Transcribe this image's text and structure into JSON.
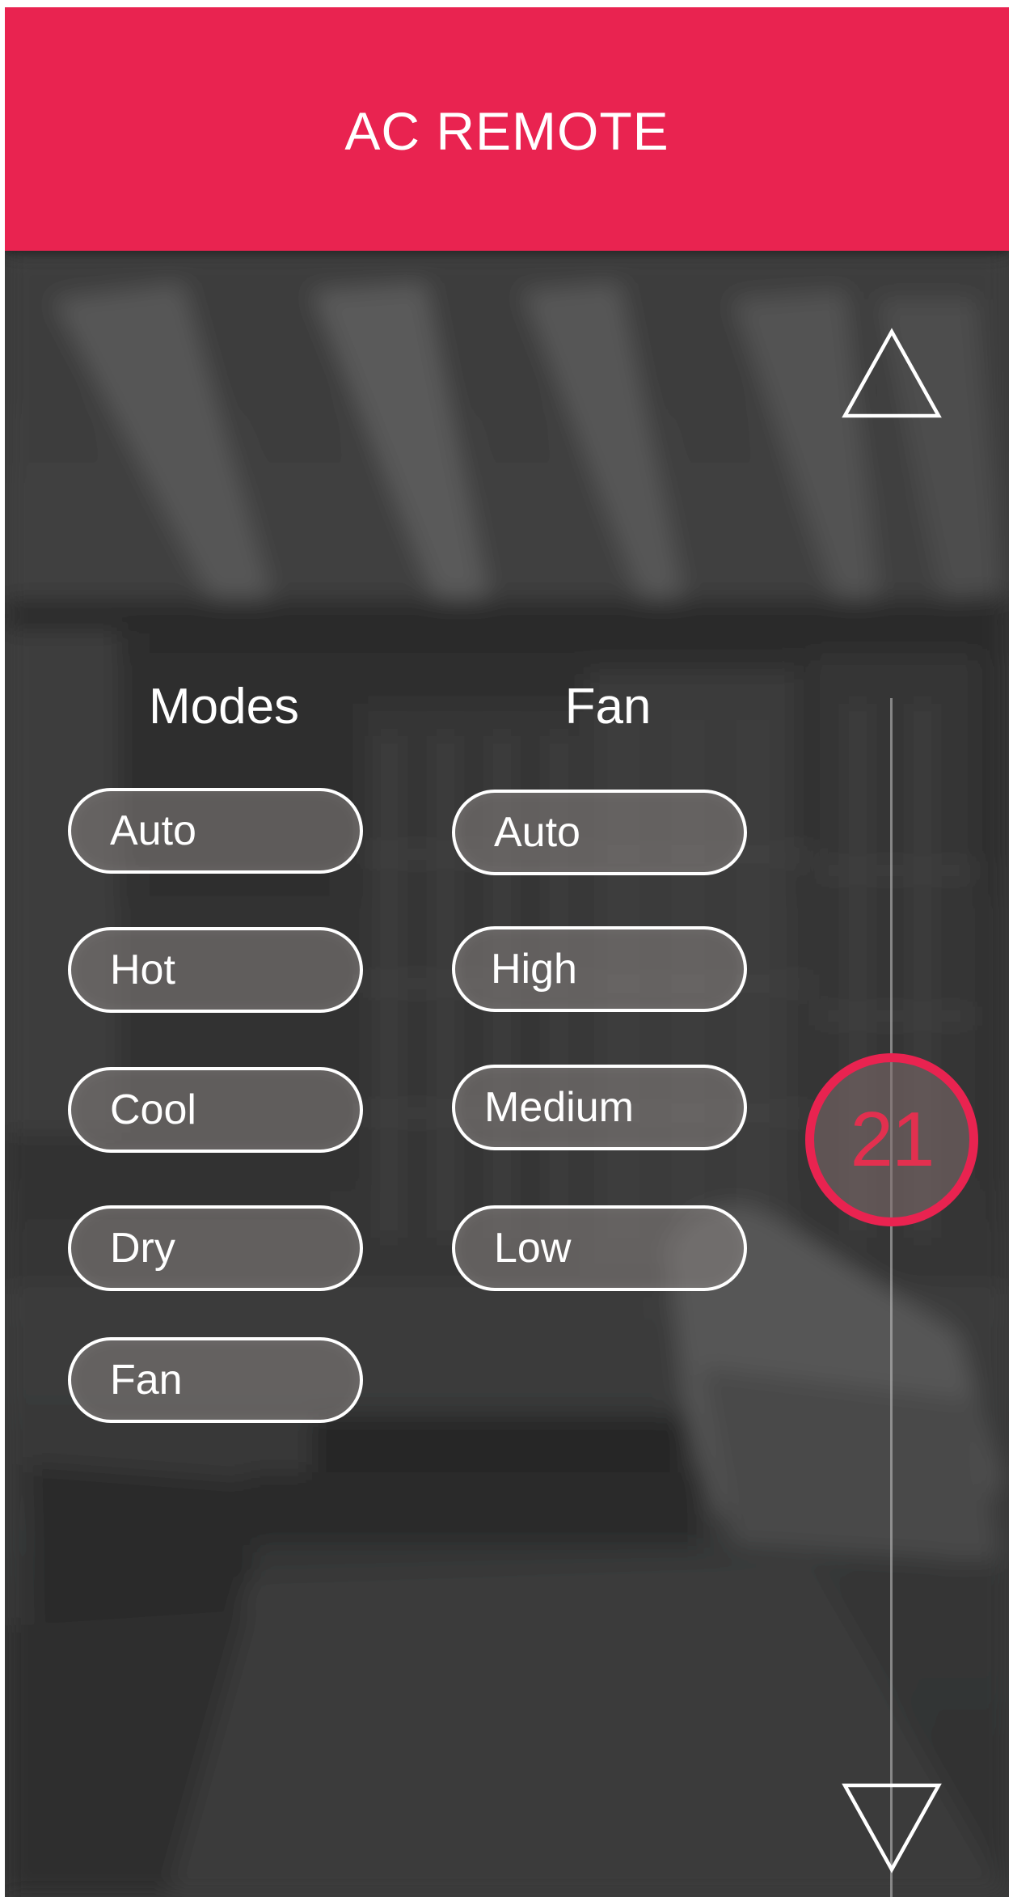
{
  "header": {
    "title": "AC REMOTE"
  },
  "colors": {
    "accent": "#e92350",
    "text": "#ffffff",
    "background": "#3a3a3a"
  },
  "modes": {
    "title": "Modes",
    "options": [
      "Auto",
      "Hot",
      "Cool",
      "Dry",
      "Fan"
    ]
  },
  "fan": {
    "title": "Fan",
    "options": [
      "Auto",
      "High",
      "Medium",
      "Low"
    ]
  },
  "temperature": {
    "value": "21",
    "increase_icon": "triangle-up-icon",
    "decrease_icon": "triangle-down-icon"
  }
}
